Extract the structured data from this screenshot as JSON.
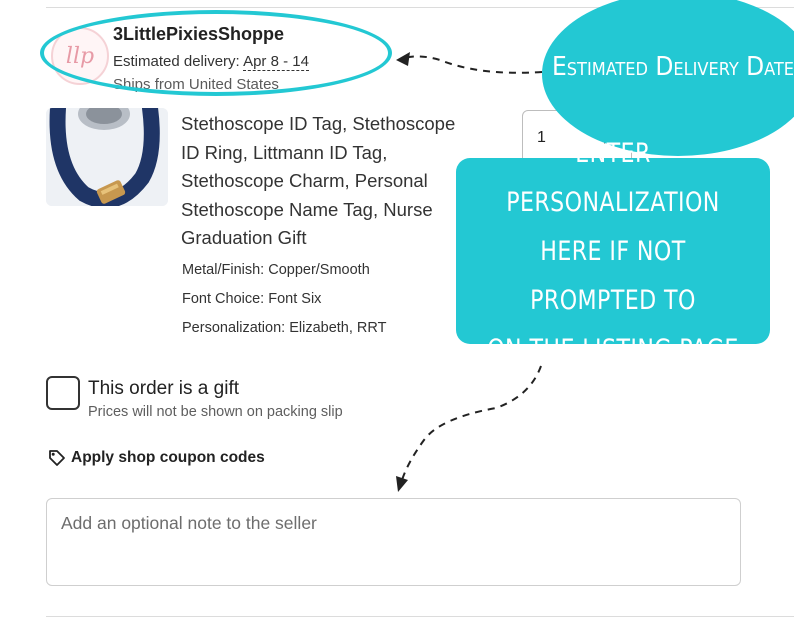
{
  "shop": {
    "logo_text": "llp",
    "name": "3LittlePixiesShoppe",
    "delivery_label": "Estimated delivery:",
    "delivery_dates": "Apr 8 - 14",
    "ships_from": "Ships from United States"
  },
  "product": {
    "title": "Stethoscope ID Tag, Stethoscope\nID Ring, Littmann ID Tag,\nStethoscope Charm, Personal\nStethoscope Name Tag, Nurse\nGraduation Gift",
    "variations": [
      "Metal/Finish: Copper/Smooth",
      "Font Choice: Font Six",
      "Personalization: Elizabeth, RRT"
    ],
    "quantity": "1"
  },
  "callouts": {
    "delivery_date": "Estimated Delivery Date",
    "personalization": "Enter personalization\nhere if not prompted to\non the  listing page"
  },
  "gift": {
    "label": "This order is a gift",
    "sublabel": "Prices will not be shown on packing slip",
    "checked": false
  },
  "coupon": {
    "label": "Apply shop coupon codes"
  },
  "note": {
    "placeholder": "Add an optional note to the seller",
    "value": ""
  },
  "colors": {
    "accent": "#23c8d3",
    "text": "#222222",
    "border": "#cfcfcf"
  },
  "icons": {
    "quantity_chevron": "chevron-down-icon",
    "coupon": "tag-icon"
  }
}
